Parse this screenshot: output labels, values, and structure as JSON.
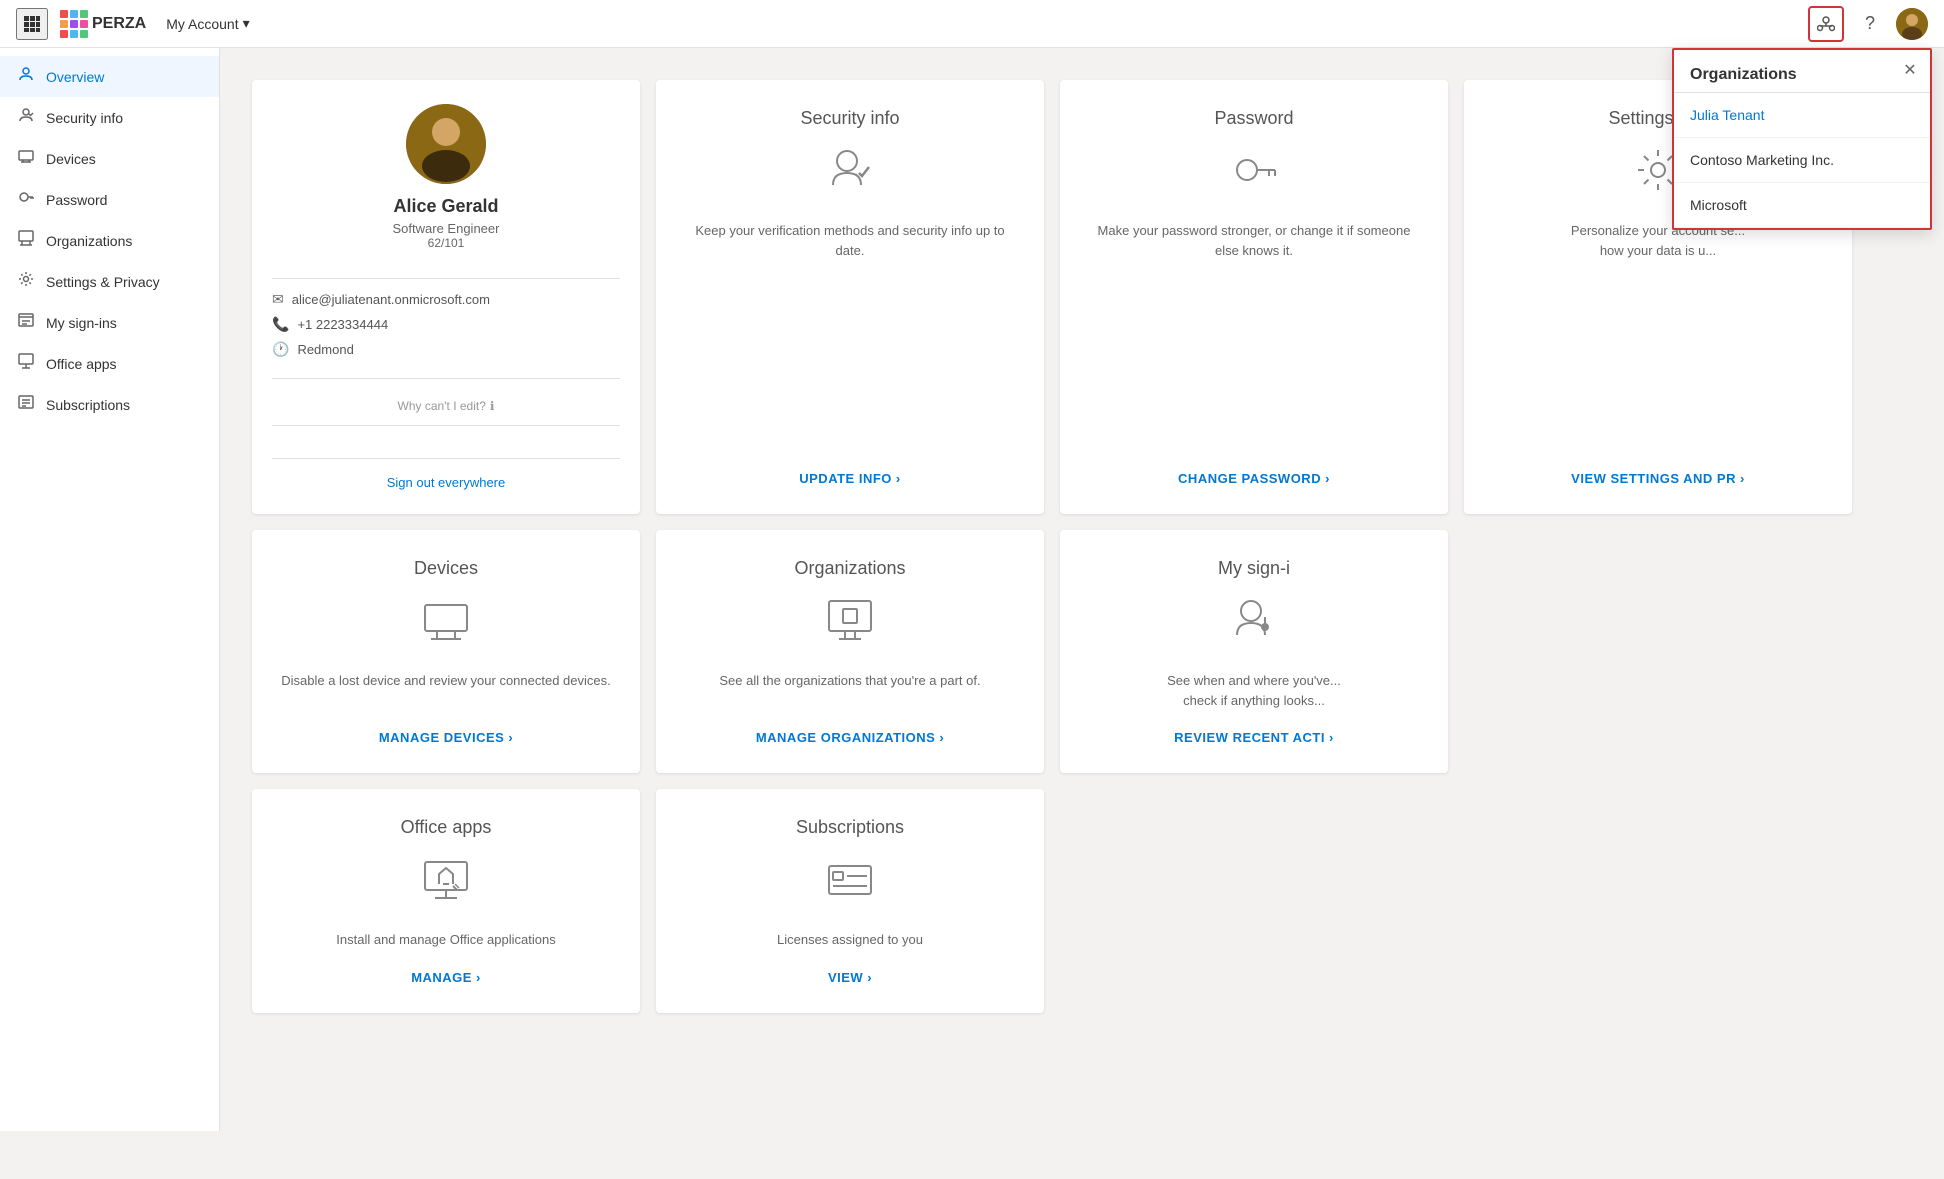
{
  "topNav": {
    "appGridLabel": "App launcher",
    "logoText": "PERZA",
    "myAccountLabel": "My Account",
    "orgIconLabel": "Organizations icon",
    "helpIconLabel": "Help",
    "avatarLabel": "User avatar"
  },
  "sidebar": {
    "items": [
      {
        "id": "overview",
        "label": "Overview",
        "icon": "👤",
        "active": true
      },
      {
        "id": "security-info",
        "label": "Security info",
        "icon": "🔒"
      },
      {
        "id": "devices",
        "label": "Devices",
        "icon": "💻"
      },
      {
        "id": "password",
        "label": "Password",
        "icon": "🔑"
      },
      {
        "id": "organizations",
        "label": "Organizations",
        "icon": "🏢"
      },
      {
        "id": "settings-privacy",
        "label": "Settings & Privacy",
        "icon": "⚙️"
      },
      {
        "id": "my-sign-ins",
        "label": "My sign-ins",
        "icon": "📊"
      },
      {
        "id": "office-apps",
        "label": "Office apps",
        "icon": "📦"
      },
      {
        "id": "subscriptions",
        "label": "Subscriptions",
        "icon": "📋"
      }
    ]
  },
  "profile": {
    "name": "Alice Gerald",
    "title": "Software Engineer",
    "fraction": "62/101",
    "email": "alice@juliatenant.onmicrosoft.com",
    "phone": "+1 2223334444",
    "location": "Redmond",
    "whyCantEdit": "Why can't I edit?",
    "signOutText": "Sign out everywhere"
  },
  "cards": [
    {
      "id": "security-info",
      "title": "Security info",
      "description": "Keep your verification methods and security info up to date.",
      "actionLabel": "UPDATE INFO",
      "actionArrow": "›"
    },
    {
      "id": "password",
      "title": "Password",
      "description": "Make your password stronger, or change it if someone else knows it.",
      "actionLabel": "CHANGE PASSWORD",
      "actionArrow": "›"
    },
    {
      "id": "settings-privacy",
      "title": "Settings & P",
      "description": "Personalize your account se... how your data is u...",
      "actionLabel": "VIEW SETTINGS AND PR",
      "actionArrow": "›"
    },
    {
      "id": "devices",
      "title": "Devices",
      "description": "Disable a lost device and review your connected devices.",
      "actionLabel": "MANAGE DEVICES",
      "actionArrow": "›"
    },
    {
      "id": "organizations",
      "title": "Organizations",
      "description": "See all the organizations that you're a part of.",
      "actionLabel": "MANAGE ORGANIZATIONS",
      "actionArrow": "›"
    },
    {
      "id": "my-sign-ins",
      "title": "My sign-i",
      "description": "See when and where you've... check if anything looks...",
      "actionLabel": "REVIEW RECENT ACTI",
      "actionArrow": "›"
    },
    {
      "id": "office-apps",
      "title": "Office apps",
      "description": "Install and manage Office applications",
      "actionLabel": "MANAGE",
      "actionArrow": "›"
    },
    {
      "id": "subscriptions",
      "title": "Subscriptions",
      "description": "Licenses assigned to you",
      "actionLabel": "VIEW",
      "actionArrow": "›"
    }
  ],
  "orgPanel": {
    "title": "Organizations",
    "closeLabel": "Close",
    "orgs": [
      {
        "id": "julia-tenant",
        "name": "Julia Tenant",
        "active": true
      },
      {
        "id": "contoso-marketing",
        "name": "Contoso Marketing Inc.",
        "active": false
      },
      {
        "id": "microsoft",
        "name": "Microsoft",
        "active": false
      }
    ]
  }
}
